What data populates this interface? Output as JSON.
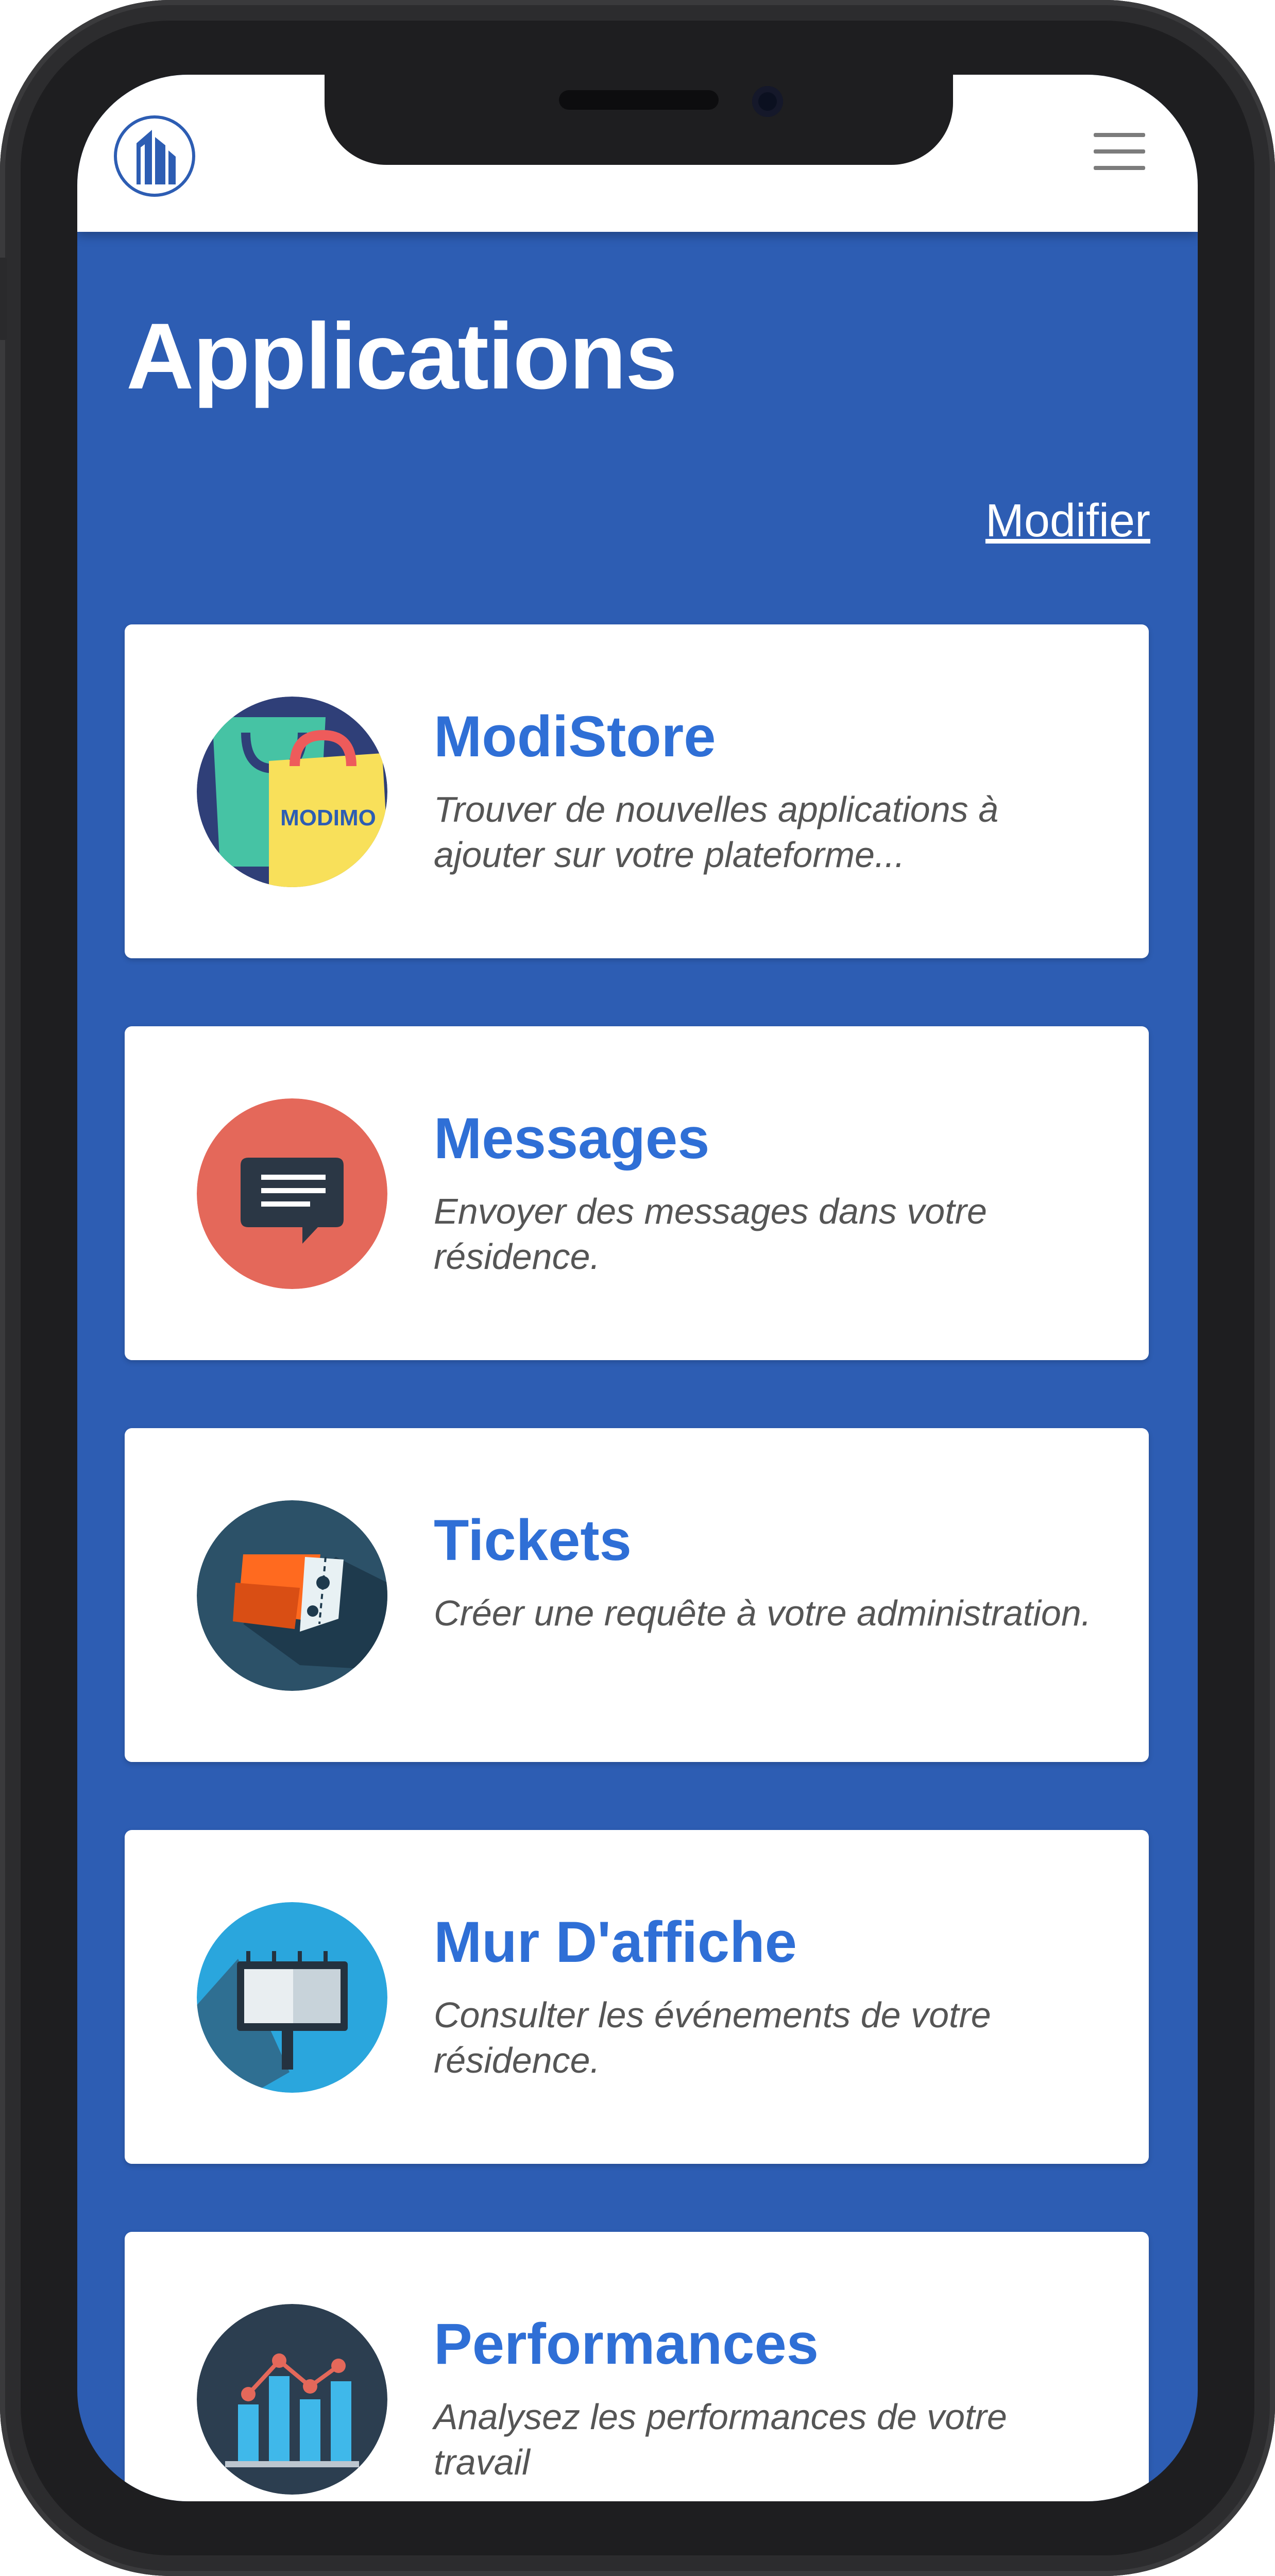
{
  "page": {
    "title": "Applications",
    "edit_link": "Modifier"
  },
  "apps": [
    {
      "name": "ModiStore",
      "description": "Trouver de nouvelles applications à ajouter sur votre plateforme...",
      "icon": "shopping-bag-icon",
      "icon_label": "MODIMO"
    },
    {
      "name": "Messages",
      "description": "Envoyer des messages dans votre résidence.",
      "icon": "chat-bubble-icon"
    },
    {
      "name": "Tickets",
      "description": "Créer une requête à votre administration.",
      "icon": "ticket-icon"
    },
    {
      "name": "Mur D'affiche",
      "description": "Consulter les événements de votre résidence.",
      "icon": "billboard-icon"
    },
    {
      "name": "Performances",
      "description": "Analysez les performances de votre travail",
      "icon": "bar-chart-icon"
    }
  ],
  "colors": {
    "background": "#2d5db3",
    "card": "#ffffff",
    "title_text": "#2f6fd6",
    "description_text": "#555555"
  }
}
